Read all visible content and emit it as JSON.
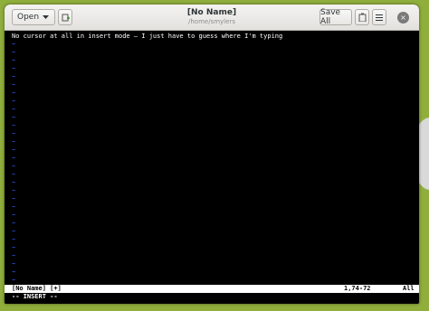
{
  "window": {
    "title": "[No Name]",
    "subtitle": "/home/smylers",
    "open_label": "Open",
    "save_all_label": "Save All",
    "close_glyph": "×"
  },
  "editor": {
    "text_line": "No cursor at all in insert mode — I just have to guess where I'm typing",
    "tilde_char": "~",
    "status_left": "[No Name] [+]",
    "status_position": "1,74-72",
    "status_scroll": "All",
    "mode_line": "-- INSERT --"
  },
  "icons": {
    "open_dropdown": "chevron-down-icon",
    "new_tab": "new-document-icon",
    "copy": "clipboard-icon",
    "menu": "hamburger-menu-icon",
    "close": "close-icon"
  },
  "colors": {
    "desktop_bg": "#8fae3c",
    "tilde": "#3060ff",
    "status_bg": "#ffffff"
  }
}
